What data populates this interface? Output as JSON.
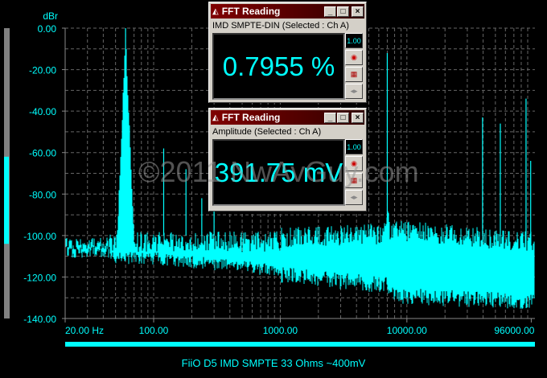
{
  "chart_data": {
    "type": "line",
    "title": "FiiO D5 IMD SMPTE 33 Ohms ~400mV",
    "ylabel": "dBr",
    "ylim": [
      -140,
      0
    ],
    "xlim": [
      20,
      96000
    ],
    "xscale": "log",
    "yticks": [
      "0.00",
      "-20.00",
      "-40.00",
      "-60.00",
      "-80.00",
      "-100.00",
      "-120.00",
      "-140.00"
    ],
    "ytick_values": [
      0,
      -20,
      -40,
      -60,
      -80,
      -100,
      -120,
      -140
    ],
    "xticks": [
      "20.00 Hz",
      "100.00",
      "1000.00",
      "10000.00",
      "96000.00"
    ],
    "xtick_values": [
      20,
      100,
      1000,
      10000,
      96000
    ],
    "grid": true,
    "series_color": "#00ffff",
    "peaks": [
      {
        "freq": 60,
        "db": 0
      },
      {
        "freq": 120,
        "db": -58
      },
      {
        "freq": 180,
        "db": -68
      },
      {
        "freq": 240,
        "db": -82
      },
      {
        "freq": 300,
        "db": -73
      },
      {
        "freq": 7000,
        "db": -12
      },
      {
        "freq": 39600,
        "db": -43
      },
      {
        "freq": 54700,
        "db": -46
      },
      {
        "freq": 87300,
        "db": -34
      },
      {
        "freq": 95000,
        "db": -64
      }
    ],
    "level_meter": {
      "range": [
        -140,
        0
      ],
      "low": -104,
      "high": -62
    }
  },
  "windows": [
    {
      "title": "FFT Reading",
      "subtitle": "IMD SMPTE-DIN (Selected : Ch A)",
      "value": "0.7955 %"
    },
    {
      "title": "FFT Reading",
      "subtitle": "Amplitude (Selected : Ch A)",
      "value": "391.75 mV"
    }
  ],
  "buttons": {
    "min": "_",
    "max": "□",
    "close": "×",
    "scale": "1.00",
    "arrows": "◂▸"
  },
  "watermark": "©2011 NwAvGuy.com",
  "caption": "FiiO D5 IMD SMPTE 33 Ohms ~400mV"
}
